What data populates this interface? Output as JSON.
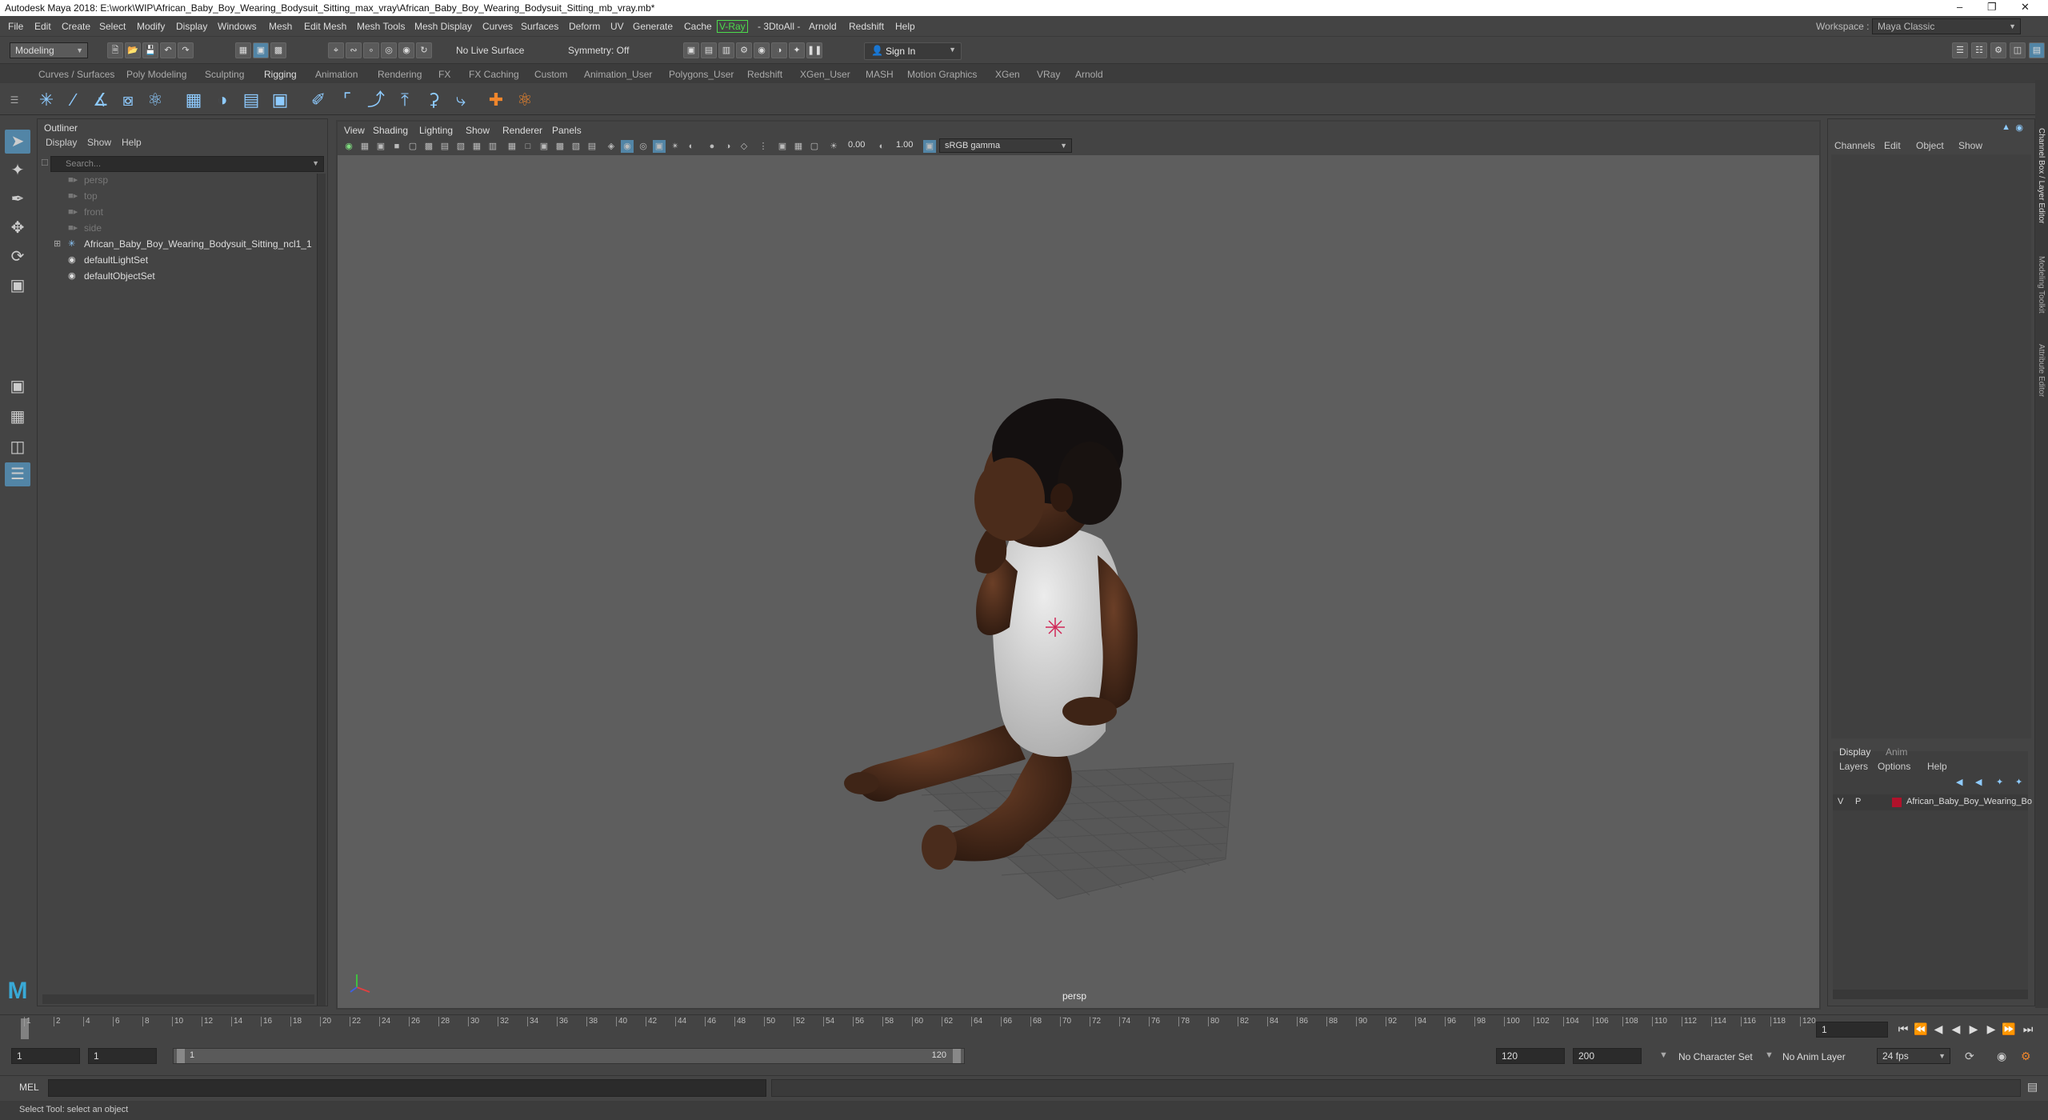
{
  "window": {
    "title": "Autodesk Maya 2018: E:\\work\\WIP\\African_Baby_Boy_Wearing_Bodysuit_Sitting_max_vray\\African_Baby_Boy_Wearing_Bodysuit_Sitting_mb_vray.mb*"
  },
  "menubar": {
    "items": [
      "File",
      "Edit",
      "Create",
      "Select",
      "Modify",
      "Display",
      "Windows",
      "Mesh",
      "Edit Mesh",
      "Mesh Tools",
      "Mesh Display",
      "Curves",
      "Surfaces",
      "Deform",
      "UV",
      "Generate",
      "Cache",
      "V-Ray",
      "- 3DtoAll -",
      "Arnold",
      "Redshift",
      "Help"
    ],
    "workspace_label": "Workspace :",
    "workspace_value": "Maya Classic"
  },
  "statusline": {
    "mode": "Modeling",
    "live_surface": "No Live Surface",
    "symmetry": "Symmetry: Off",
    "sign_in": "Sign In"
  },
  "shelf": {
    "tabs": [
      "Curves / Surfaces",
      "Poly Modeling",
      "Sculpting",
      "Rigging",
      "Animation",
      "Rendering",
      "FX",
      "FX Caching",
      "Custom",
      "Animation_User",
      "Polygons_User",
      "Redshift",
      "XGen_User",
      "MASH",
      "Motion Graphics",
      "XGen",
      "VRay",
      "Arnold"
    ],
    "active_tab": "Rigging"
  },
  "outliner": {
    "title": "Outliner",
    "menu": [
      "Display",
      "Show",
      "Help"
    ],
    "search_placeholder": "Search...",
    "items": [
      {
        "label": "persp",
        "icon": "camera-icon",
        "dim": true
      },
      {
        "label": "top",
        "icon": "camera-icon",
        "dim": true
      },
      {
        "label": "front",
        "icon": "camera-icon",
        "dim": true
      },
      {
        "label": "side",
        "icon": "camera-icon",
        "dim": true
      },
      {
        "label": "African_Baby_Boy_Wearing_Bodysuit_Sitting_ncl1_1",
        "icon": "joint-icon",
        "dim": false
      },
      {
        "label": "defaultLightSet",
        "icon": "set-icon",
        "dim": false
      },
      {
        "label": "defaultObjectSet",
        "icon": "set-icon",
        "dim": false
      }
    ]
  },
  "viewport": {
    "menu": [
      "View",
      "Shading",
      "Lighting",
      "Show",
      "Renderer",
      "Panels"
    ],
    "exposure": "0.00",
    "gamma": "1.00",
    "color_space": "sRGB gamma",
    "camera": "persp"
  },
  "channelbox": {
    "menu": [
      "Channels",
      "Edit",
      "Object",
      "Show"
    ],
    "side_tabs": [
      "Channel Box / Layer Editor",
      "Modeling Toolkit",
      "Attribute Editor"
    ]
  },
  "layers": {
    "tabs": [
      "Display",
      "Anim"
    ],
    "menu": [
      "Layers",
      "Options",
      "Help"
    ],
    "row": {
      "v": "V",
      "p": "P",
      "name": "African_Baby_Boy_Wearing_Bo",
      "color": "#b0122b"
    }
  },
  "timeline": {
    "ticks": [
      "1",
      "2",
      "4",
      "6",
      "8",
      "10",
      "12",
      "14",
      "16",
      "18",
      "20",
      "22",
      "24",
      "26",
      "28",
      "30",
      "32",
      "34",
      "36",
      "38",
      "40",
      "42",
      "44",
      "46",
      "48",
      "50",
      "52",
      "54",
      "56",
      "58",
      "60",
      "62",
      "64",
      "66",
      "68",
      "70",
      "72",
      "74",
      "76",
      "78",
      "80",
      "82",
      "84",
      "86",
      "88",
      "90",
      "92",
      "94",
      "96",
      "98",
      "100",
      "102",
      "104",
      "106",
      "108",
      "110",
      "112",
      "114",
      "116",
      "118",
      "120"
    ],
    "current_frame": "1"
  },
  "range": {
    "start": "1",
    "start_inner": "1",
    "slider_start": "1",
    "slider_end": "120",
    "end_inner": "120",
    "end": "200",
    "character_set": "No Character Set",
    "anim_layer": "No Anim Layer",
    "fps": "24 fps"
  },
  "cmdline": {
    "label": "MEL"
  },
  "helpline": {
    "text": "Select Tool: select an object"
  },
  "colors": {
    "accent": "#5285a6",
    "viewport_bg": "#5e5e5e",
    "vray_green": "#4cdb4c"
  }
}
